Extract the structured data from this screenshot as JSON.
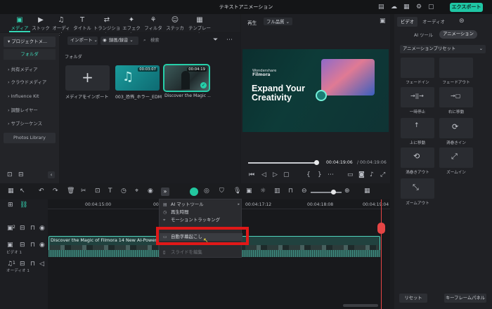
{
  "window": {
    "title": "テキストアニメーション",
    "export_label": "エクスポート ⌄"
  },
  "media_tabs": [
    {
      "label": "メディア",
      "icon": "media-icon",
      "glyph": "▣"
    },
    {
      "label": "ストック",
      "icon": "stock-icon",
      "glyph": "▶"
    },
    {
      "label": "オーディオ",
      "icon": "music-note-icon",
      "glyph": "♫"
    },
    {
      "label": "タイトル",
      "icon": "title-text-icon",
      "glyph": "T"
    },
    {
      "label": "トランジション",
      "icon": "transition-icon",
      "glyph": "⇄"
    },
    {
      "label": "エフェクト",
      "icon": "effects-icon",
      "glyph": "✦"
    },
    {
      "label": "フィルター",
      "icon": "filter-icon",
      "glyph": "⚘"
    },
    {
      "label": "ステッカー",
      "icon": "sticker-icon",
      "glyph": "☺"
    },
    {
      "label": "テンプレート",
      "icon": "template-icon",
      "glyph": "▦"
    }
  ],
  "sidebar": {
    "project_label": "プロジェクトメ...",
    "folder_label": "フォルダ",
    "items": [
      "共有メディア",
      "クラウドメディア",
      "Influence Kit",
      "調整レイヤー",
      "サブシーケンス"
    ],
    "library_label": "Photos Library"
  },
  "media": {
    "import_label": "インポート",
    "record_label": "録画/録音",
    "search_placeholder": "検索",
    "folder_heading": "フォルダ",
    "items": [
      {
        "label": "メディアをインポート",
        "duration": ""
      },
      {
        "label": "003_恐怖_ホラー_EDM",
        "duration": "00:03:07"
      },
      {
        "label": "Discover the Magic ...",
        "duration": "00:04:19"
      }
    ]
  },
  "preview": {
    "playback_label": "再生",
    "quality_label": "フル品質",
    "brand_name": "Wondershare",
    "brand_product": "Filmora",
    "headline_line1": "Expand Your",
    "headline_line2": "Creativity",
    "current_time": "00:04:19:06",
    "total_time": "/ 00:04:19:06",
    "progress": 1.0
  },
  "right_panel": {
    "tabs": [
      "ビデオ",
      "オーディオ"
    ],
    "subtabs": [
      "AI ツール",
      "アニメーション"
    ],
    "preset_label": "アニメーションプリセット",
    "animations": [
      "フェードイン",
      "フェードアウト",
      "一時停止",
      "右に移動",
      "上に移動",
      "渦巻きイン",
      "渦巻きアウト",
      "ズームイン",
      "ズームアウト"
    ],
    "reset_label": "リセット",
    "keyframe_label": "キーフレームパネル"
  },
  "timeline": {
    "ruler": [
      "00:04:15:00",
      "00:04:15:2",
      "00:04:17:12",
      "00:04:18:08",
      "00:04:19:04"
    ],
    "clip_title": "Discover the Magic of Filmora 14 New AI-Powered F",
    "track_video_label": "ビデオ 1",
    "track_audio_label": "オーディオ 1",
    "video_track_num": "2",
    "audio_track_num": "1"
  },
  "context_menu": {
    "items": [
      "AI マットツール",
      "再生時間",
      "モーショントラッキング",
      "自動字幕起こし",
      "スライドを編集"
    ]
  },
  "colors": {
    "accent": "#1fc6a4",
    "highlight": "#e01818",
    "playhead": "#e64545"
  }
}
